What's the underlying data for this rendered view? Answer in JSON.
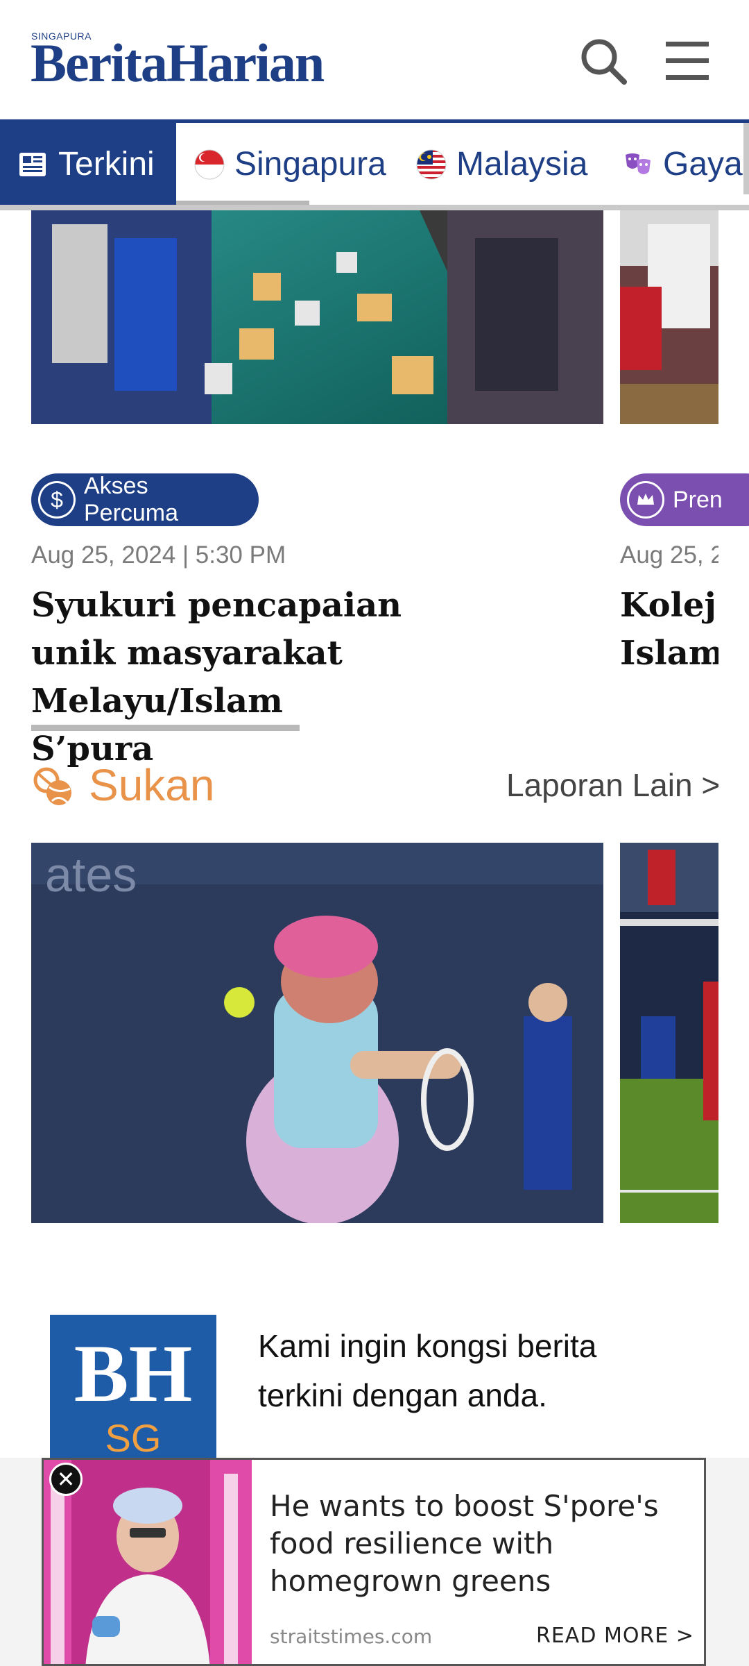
{
  "header": {
    "logo_sub": "SINGAPURA",
    "logo_main": "BeritaHarian"
  },
  "nav": {
    "items": [
      {
        "label": "Terkini",
        "icon": "newspaper-icon"
      },
      {
        "label": "Singapura",
        "icon": "singapore-flag-icon"
      },
      {
        "label": "Malaysia",
        "icon": "malaysia-flag-icon"
      },
      {
        "label": "Gaya",
        "icon": "masks-icon"
      }
    ]
  },
  "articles": [
    {
      "badge": "Akses Percuma",
      "badge_icon": "dollar-icon",
      "date": "Aug 25, 2024 | 5:30 PM",
      "headline_lines": [
        "Syukuri pencapaian",
        "unik masyarakat Melayu/Islam",
        "S’pura"
      ]
    },
    {
      "badge": "Pren",
      "badge_icon": "crown-icon",
      "date": "Aug 25, 2",
      "headline_lines": [
        "Kolej s",
        "Islam"
      ]
    }
  ],
  "sport": {
    "title": "Sukan",
    "more": "Laporan Lain >",
    "icon": "sports-balls-icon"
  },
  "promo": {
    "logo_line1": "BH",
    "logo_line2": "SG",
    "text": "Kami ingin kongsi berita terkini dengan anda."
  },
  "ad": {
    "headline": "He wants to boost S'pore's food resilience with homegrown greens",
    "source": "straitstimes.com",
    "cta": "READ MORE >"
  },
  "colors": {
    "brand": "#1e3f86",
    "sport": "#e8924a",
    "premium": "#7b4fb0"
  }
}
